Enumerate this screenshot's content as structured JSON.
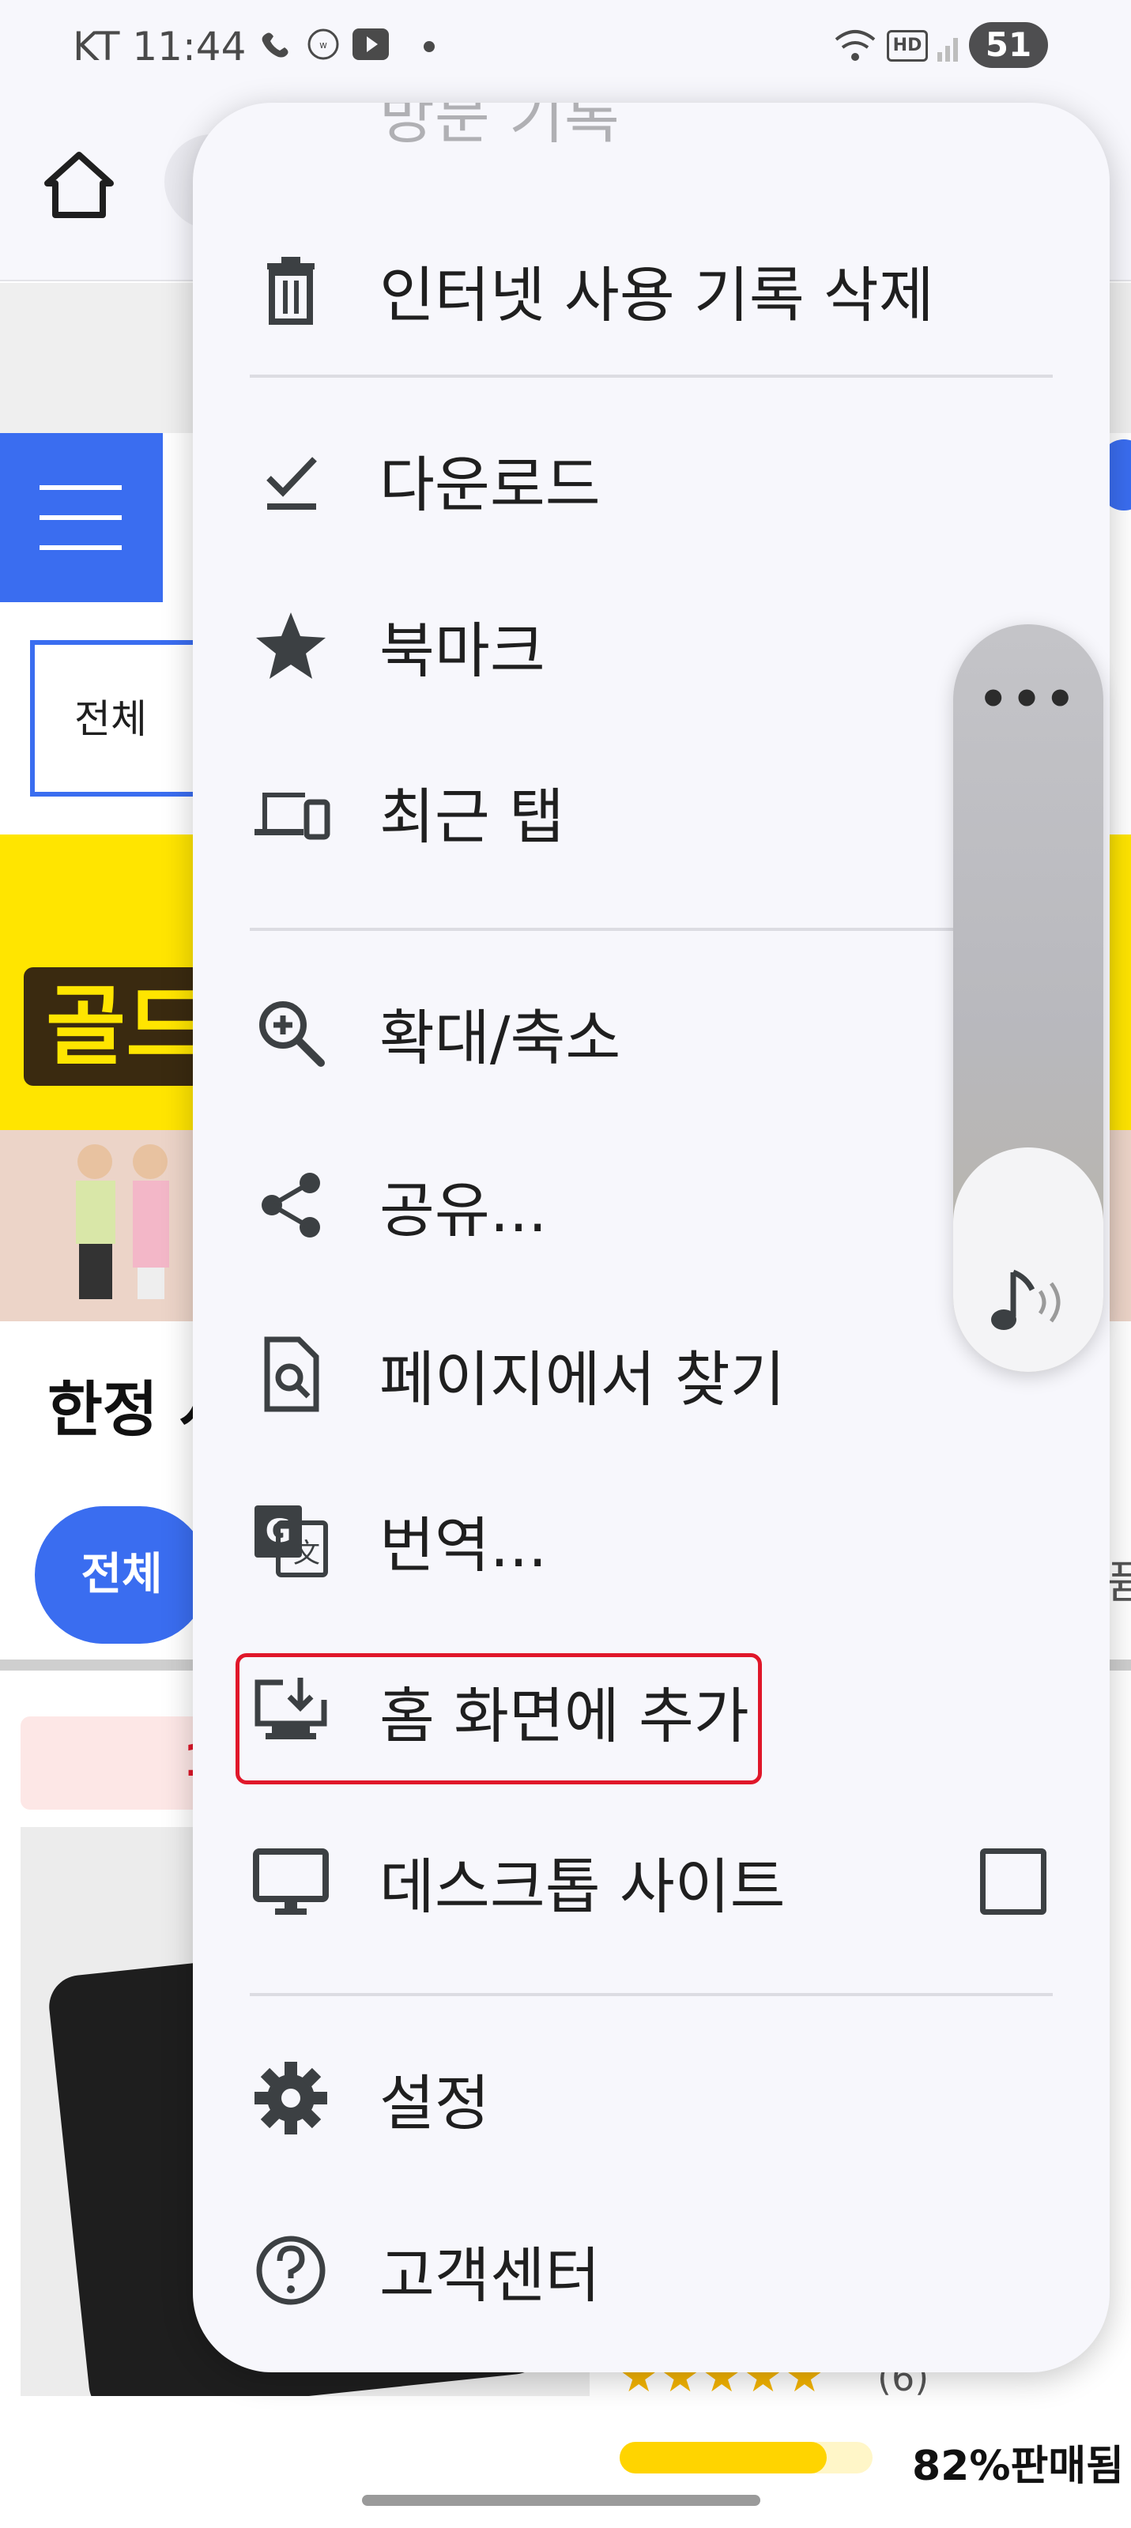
{
  "status_bar": {
    "carrier_time": "KT 11:44",
    "battery": "51"
  },
  "page": {
    "category_select": "전체",
    "banner_logo": "골드",
    "section_title": "한정 시",
    "filter_pill": "전체",
    "badge_fragment": "1",
    "rating_count": "(6)",
    "stars": "★★★★★",
    "sold_percent": 82,
    "sold_text": "82%판매됨",
    "right_edge_fragment": "퓸"
  },
  "menu": {
    "history_peek": "방문 기록",
    "items": [
      {
        "label": "인터넷 사용 기록 삭제",
        "icon": "trash-icon"
      },
      {
        "label": "다운로드",
        "icon": "download-check-icon"
      },
      {
        "label": "북마크",
        "icon": "star-icon"
      },
      {
        "label": "최근 탭",
        "icon": "devices-icon"
      },
      {
        "label": "확대/축소",
        "icon": "zoom-in-icon"
      },
      {
        "label": "공유...",
        "icon": "share-icon"
      },
      {
        "label": "페이지에서 찾기",
        "icon": "find-in-page-icon"
      },
      {
        "label": "번역...",
        "icon": "translate-icon"
      },
      {
        "label": "홈 화면에 추가",
        "icon": "add-to-home-icon"
      },
      {
        "label": "데스크톱 사이트",
        "icon": "desktop-icon",
        "checked": false
      },
      {
        "label": "설정",
        "icon": "gear-icon"
      },
      {
        "label": "고객센터",
        "icon": "help-icon"
      }
    ]
  },
  "volume": {
    "level": 0.3
  },
  "colors": {
    "accent_blue": "#3a6df0",
    "highlight_red": "#e0172a",
    "banner_yellow": "#ffe500",
    "menu_bg": "#f7f7fc"
  }
}
